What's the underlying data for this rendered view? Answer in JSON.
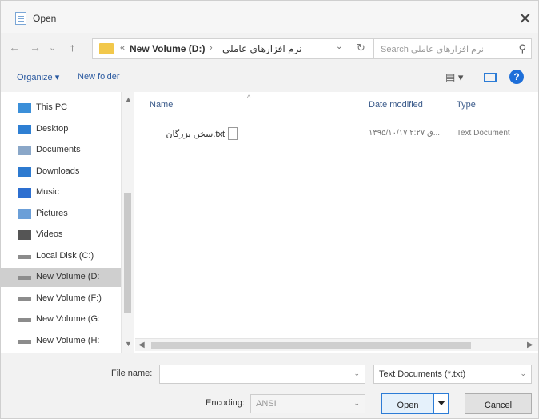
{
  "window": {
    "title": "Open",
    "close_glyph": "✕"
  },
  "nav_buttons": {
    "back": "←",
    "forward": "→",
    "recent": "⌄",
    "up": "↑"
  },
  "address": {
    "separator": "›",
    "root_glyph": "«",
    "crumbs": [
      "New Volume (D:)",
      "نرم افزارهای عاملی"
    ],
    "dropdown_glyph": "⌄",
    "refresh_glyph": "↻"
  },
  "search": {
    "placeholder": "Search نرم افزارهای عاملی",
    "icon": "search-icon"
  },
  "toolbar": {
    "organize": "Organize ▾",
    "new_folder": "New folder",
    "view_glyph": "▤ ▾",
    "help_glyph": "?"
  },
  "nav_pane": {
    "items": [
      {
        "label": "This PC",
        "icon": "computer-icon",
        "color": "#3b8fd9"
      },
      {
        "label": "Desktop",
        "icon": "desktop-icon",
        "color": "#2e7fd3"
      },
      {
        "label": "Documents",
        "icon": "documents-icon",
        "color": "#8aa7c8"
      },
      {
        "label": "Downloads",
        "icon": "downloads-icon",
        "color": "#2d7ad0"
      },
      {
        "label": "Music",
        "icon": "music-icon",
        "color": "#2d6fd0"
      },
      {
        "label": "Pictures",
        "icon": "pictures-icon",
        "color": "#6b9fd8"
      },
      {
        "label": "Videos",
        "icon": "videos-icon",
        "color": "#555555"
      },
      {
        "label": "Local Disk (C:)",
        "icon": "drive-icon",
        "color": "#8c8c8c"
      },
      {
        "label": "New Volume (D:",
        "icon": "drive-icon",
        "color": "#8c8c8c"
      },
      {
        "label": "New Volume (F:)",
        "icon": "drive-icon",
        "color": "#8c8c8c"
      },
      {
        "label": "New Volume (G:",
        "icon": "drive-icon",
        "color": "#8c8c8c"
      },
      {
        "label": "New Volume (H:",
        "icon": "drive-icon",
        "color": "#8c8c8c"
      }
    ],
    "selected_index": 8,
    "scroll_up": "▲",
    "scroll_down": "▼"
  },
  "file_list": {
    "columns": {
      "name": "Name",
      "date": "Date modified",
      "type": "Type"
    },
    "sort_glyph": "^",
    "rows": [
      {
        "name": "سخن بزرگان.txt",
        "date": "۱۳۹۵/۱۰/۱۷ ۲:۲۷ ق...",
        "type": "Text Document"
      }
    ],
    "scroll_left": "◀",
    "scroll_right": "▶"
  },
  "bottom": {
    "file_name_label": "File name:",
    "file_name_value": "",
    "filter_value": "Text Documents (*.txt)",
    "encoding_label": "Encoding:",
    "encoding_value": "ANSI",
    "open_label": "Open",
    "cancel_label": "Cancel",
    "dropdown_glyph": "⌄"
  },
  "colors": {
    "accent": "#2c7cd6",
    "folder": "#f2c84b",
    "selected": "#cfcfcf"
  }
}
